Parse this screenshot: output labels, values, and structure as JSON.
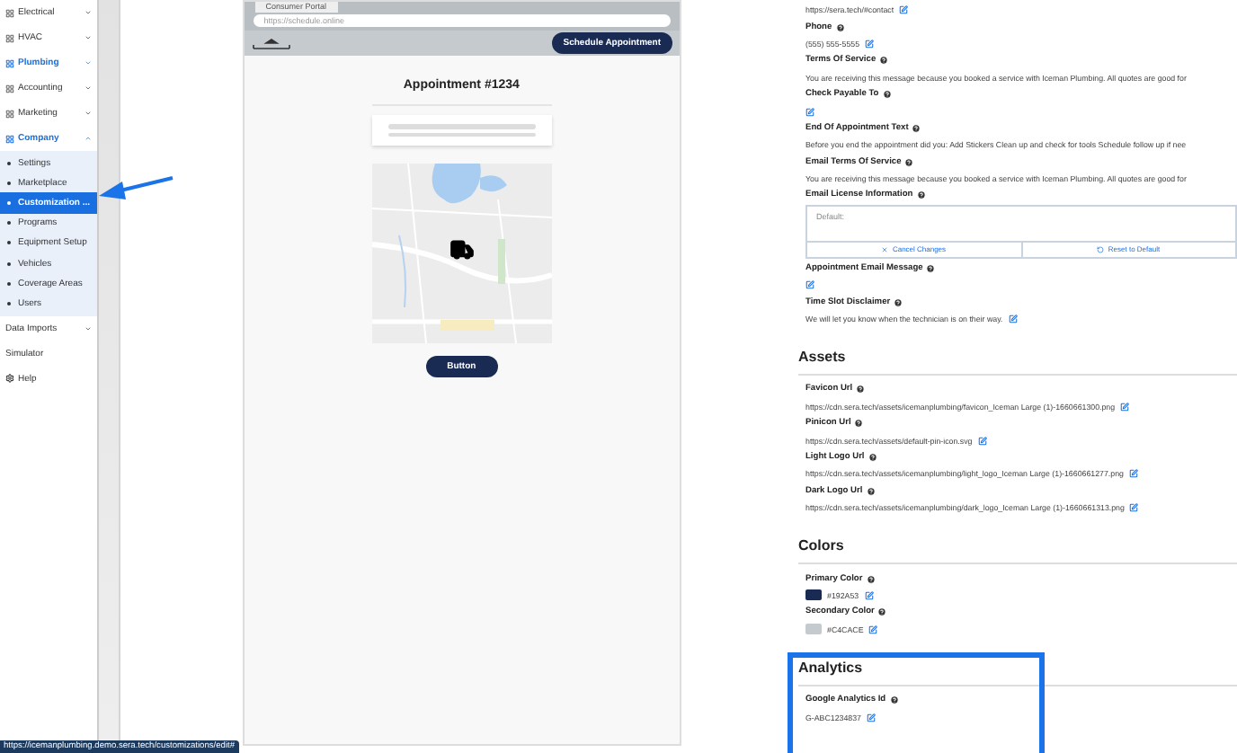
{
  "sidebar": {
    "items": [
      {
        "label": "Electrical",
        "kind": "module",
        "highlighted": false,
        "expanded": false
      },
      {
        "label": "HVAC",
        "kind": "module",
        "highlighted": false,
        "expanded": false
      },
      {
        "label": "Plumbing",
        "kind": "module",
        "highlighted": true,
        "expanded": false
      },
      {
        "label": "Accounting",
        "kind": "module",
        "highlighted": false,
        "expanded": false
      },
      {
        "label": "Marketing",
        "kind": "module",
        "highlighted": false,
        "expanded": false
      },
      {
        "label": "Company",
        "kind": "module",
        "highlighted": true,
        "expanded": true,
        "children": [
          {
            "label": "Settings",
            "selected": false
          },
          {
            "label": "Marketplace",
            "selected": false
          },
          {
            "label": "Customization ...",
            "selected": true
          },
          {
            "label": "Programs",
            "selected": false
          },
          {
            "label": "Equipment Setup",
            "selected": false
          },
          {
            "label": "Vehicles",
            "selected": false
          },
          {
            "label": "Coverage Areas",
            "selected": false
          },
          {
            "label": "Users",
            "selected": false
          }
        ]
      },
      {
        "label": "Data Imports",
        "kind": "folder",
        "highlighted": false,
        "expanded": false
      },
      {
        "label": "Simulator",
        "kind": "plain",
        "highlighted": false
      },
      {
        "label": "Help",
        "kind": "help",
        "highlighted": false
      }
    ]
  },
  "preview": {
    "tab": "Consumer Portal",
    "url_placeholder": "https://schedule.online",
    "header_button": "Schedule Appointment",
    "title": "Appointment #1234",
    "button": "Button"
  },
  "sections": [
    {
      "fields": [
        {
          "kind": "text",
          "value": "https://sera.tech/#contact"
        },
        {
          "kind": "text",
          "label": "Phone",
          "value": "(555) 555-5555"
        },
        {
          "kind": "plain",
          "label": "Terms Of Service",
          "value": "You are receiving this message because you booked a service with Iceman Plumbing. All quotes are good for"
        },
        {
          "kind": "edit",
          "label": "Check Payable To"
        },
        {
          "kind": "plain",
          "label": "End Of Appointment Text",
          "value": "Before you end the appointment did you: Add Stickers Clean up and check for tools Schedule follow up if nee"
        },
        {
          "kind": "plain",
          "label": "Email Terms Of Service",
          "value": "You are receiving this message because you booked a service with Iceman Plumbing. All quotes are good for"
        },
        {
          "kind": "editor",
          "label": "Email License Information",
          "placeholder": "Default:",
          "cancel": "Cancel Changes",
          "reset": "Reset to Default"
        },
        {
          "kind": "edit",
          "label": "Appointment Email Message"
        },
        {
          "kind": "text",
          "label": "Time Slot Disclaimer",
          "value": "We will let you know when the technician is on their way."
        }
      ]
    },
    {
      "title": "Assets",
      "fields": [
        {
          "kind": "text",
          "label": "Favicon Url",
          "value": "https://cdn.sera.tech/assets/icemanplumbing/favicon_Iceman Large (1)-1660661300.png"
        },
        {
          "kind": "text",
          "label": "Pinicon Url",
          "value": "https://cdn.sera.tech/assets/default-pin-icon.svg"
        },
        {
          "kind": "text",
          "label": "Light Logo Url",
          "value": "https://cdn.sera.tech/assets/icemanplumbing/light_logo_Iceman Large (1)-1660661277.png"
        },
        {
          "kind": "text",
          "label": "Dark Logo Url",
          "value": "https://cdn.sera.tech/assets/icemanplumbing/dark_logo_Iceman Large (1)-1660661313.png"
        }
      ]
    },
    {
      "title": "Colors",
      "fields": [
        {
          "kind": "color",
          "label": "Primary Color",
          "value": "#192A53",
          "color": "#192a53"
        },
        {
          "kind": "color",
          "label": "Secondary Color",
          "value": "#C4CACE",
          "color": "#c4cace"
        }
      ]
    },
    {
      "title": "Analytics",
      "highlighted": true,
      "fields": [
        {
          "kind": "text",
          "label": "Google Analytics Id",
          "value": "G-ABC1234837"
        }
      ]
    }
  ],
  "status_bar": "https://icemanplumbing.demo.sera.tech/customizations/edit#"
}
